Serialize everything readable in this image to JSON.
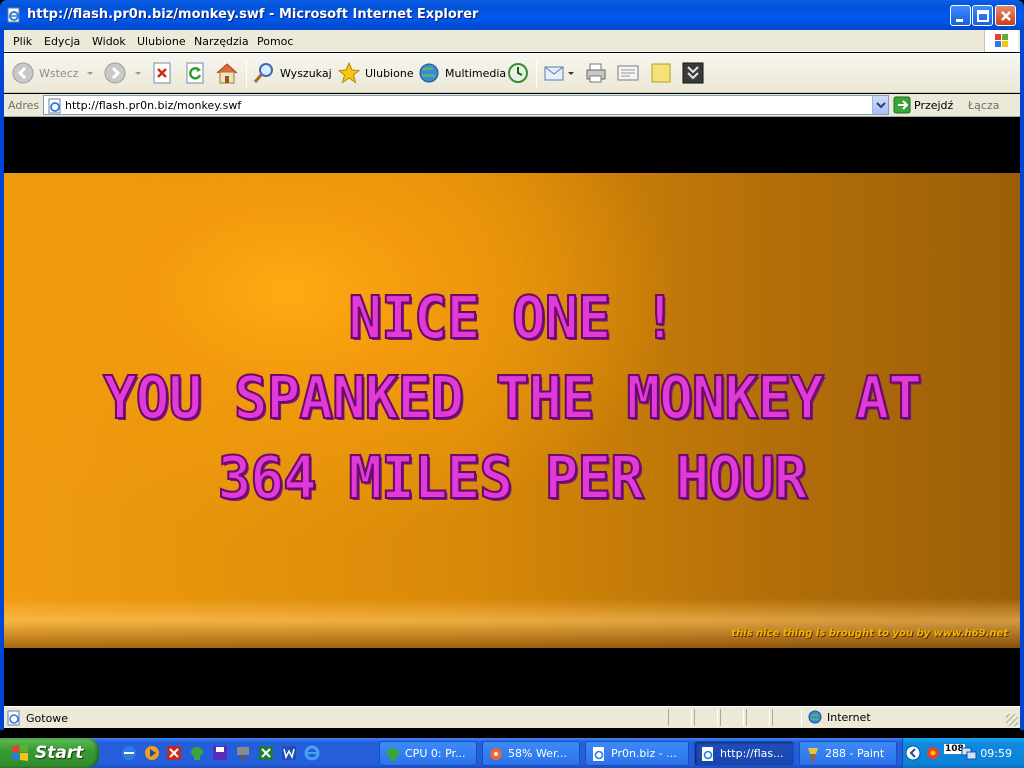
{
  "window": {
    "title": "http://flash.pr0n.biz/monkey.swf - Microsoft Internet Explorer"
  },
  "menu": {
    "items": [
      "Plik",
      "Edycja",
      "Widok",
      "Ulubione",
      "Narzędzia",
      "Pomoc"
    ]
  },
  "toolbar": {
    "back_label": "Wstecz",
    "search_label": "Wyszukaj",
    "favorites_label": "Ulubione",
    "media_label": "Multimedia"
  },
  "address": {
    "label": "Adres",
    "url": "http://flash.pr0n.biz/monkey.swf",
    "go_label": "Przejdź",
    "links_label": "Łącza"
  },
  "content": {
    "line1": "NICE ONE !",
    "line2": "YOU SPANKED THE MONKEY AT",
    "line3": "364 MILES PER HOUR",
    "credit": "this nice thing is brought to you by www.h69.net"
  },
  "status": {
    "text": "Gotowe",
    "zone": "Internet"
  },
  "taskbar": {
    "start_label": "Start",
    "tasks": [
      "CPU 0: Pr...",
      "58% Wer...",
      "Pr0n.biz - ...",
      "http://flas...",
      "288 - Paint"
    ],
    "tray_badge": "108",
    "clock": "09:59"
  }
}
